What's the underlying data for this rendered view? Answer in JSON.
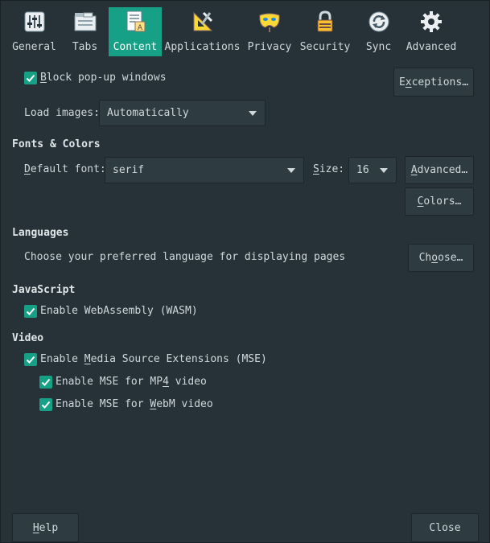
{
  "toolbar": {
    "tabs": [
      {
        "label": "General",
        "icon": "sliders-icon"
      },
      {
        "label": "Tabs",
        "icon": "tabs-icon"
      },
      {
        "label": "Content",
        "icon": "content-icon"
      },
      {
        "label": "Applications",
        "icon": "applications-icon"
      },
      {
        "label": "Privacy",
        "icon": "mask-icon"
      },
      {
        "label": "Security",
        "icon": "padlock-icon"
      },
      {
        "label": "Sync",
        "icon": "sync-icon"
      },
      {
        "label": "Advanced",
        "icon": "gear-icon"
      }
    ],
    "active": "Content"
  },
  "popups": {
    "label_u": "B",
    "label_rest": "lock pop-up windows",
    "checked": true,
    "exceptions_u": "x",
    "exceptions_pre": "E",
    "exceptions_post": "ceptions…"
  },
  "images": {
    "label": "Load images:",
    "value": "Automatically"
  },
  "fonts": {
    "heading": "Fonts & Colors",
    "default_font_u": "D",
    "default_font_rest": "efault font:",
    "font_value": "serif",
    "size_u": "S",
    "size_rest": "ize:",
    "size_value": "16",
    "advanced_pre": "",
    "advanced_u": "A",
    "advanced_post": "dvanced…",
    "colors_u": "C",
    "colors_post": "olors…"
  },
  "languages": {
    "heading": "Languages",
    "description": "Choose your preferred language for displaying pages",
    "choose_pre": "Ch",
    "choose_u": "o",
    "choose_post": "ose…"
  },
  "javascript": {
    "heading": "JavaScript",
    "wasm_label": "Enable WebAssembly (WASM)",
    "wasm_checked": true
  },
  "video": {
    "heading": "Video",
    "mse_pre": "Enable ",
    "mse_u": "M",
    "mse_post": "edia Source Extensions (MSE)",
    "mse_checked": true,
    "mp4_pre": "Enable MSE for MP",
    "mp4_u": "4",
    "mp4_post": " video",
    "mp4_checked": true,
    "webm_pre": "Enable MSE for ",
    "webm_u": "W",
    "webm_post": "ebM video",
    "webm_checked": true
  },
  "footer": {
    "help_u": "H",
    "help_post": "elp",
    "close_label": "Close"
  },
  "colors": {
    "background": "#263238",
    "accent": "#16a085",
    "button": "#2e3b41",
    "text": "#cfd8dc"
  }
}
